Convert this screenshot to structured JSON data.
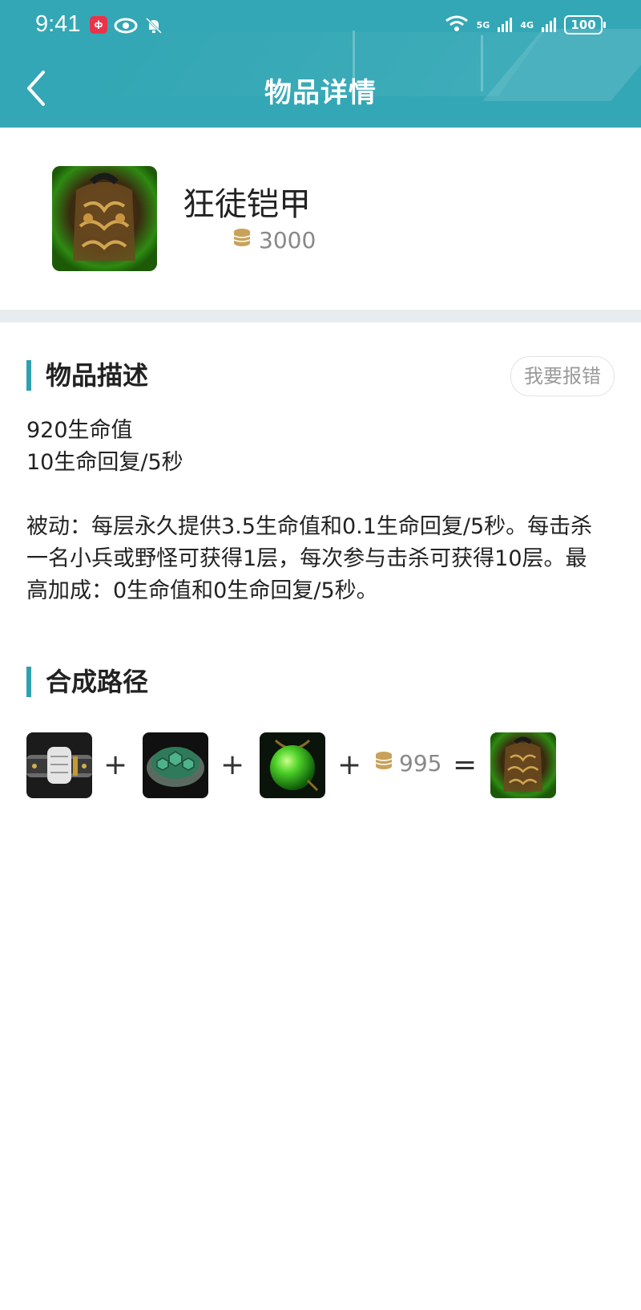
{
  "status_bar": {
    "time": "9:41",
    "app_badge": "ф",
    "net1": "5G",
    "net2": "4G",
    "battery": "100"
  },
  "header": {
    "title": "物品详情",
    "color": "#33a7b5"
  },
  "item": {
    "name": "狂徒铠甲",
    "price": "3000",
    "icon": "frenzy-armor-icon"
  },
  "description_section": {
    "title": "物品描述",
    "report_label": "我要报错",
    "lines": [
      "920生命值",
      "10生命回复/5秒"
    ],
    "passive": [
      "被动：每层永久提供3.5生命值和0.1生命回复/5秒。每击杀",
      "一名小兵或野怪可获得1层，每次参与击杀可获得10层。最",
      "高加成：0生命值和0生命回复/5秒。"
    ]
  },
  "recipe_section": {
    "title": "合成路径",
    "components": [
      {
        "icon": "belt-gauntlet-icon"
      },
      {
        "icon": "turtle-shell-ring-icon"
      },
      {
        "icon": "green-orb-icon"
      }
    ],
    "plus": "+",
    "gold": "995",
    "equals": "=",
    "result_icon": "frenzy-armor-icon"
  },
  "accent_color": "#2ea0ae",
  "gold_color": "#c9a25a"
}
